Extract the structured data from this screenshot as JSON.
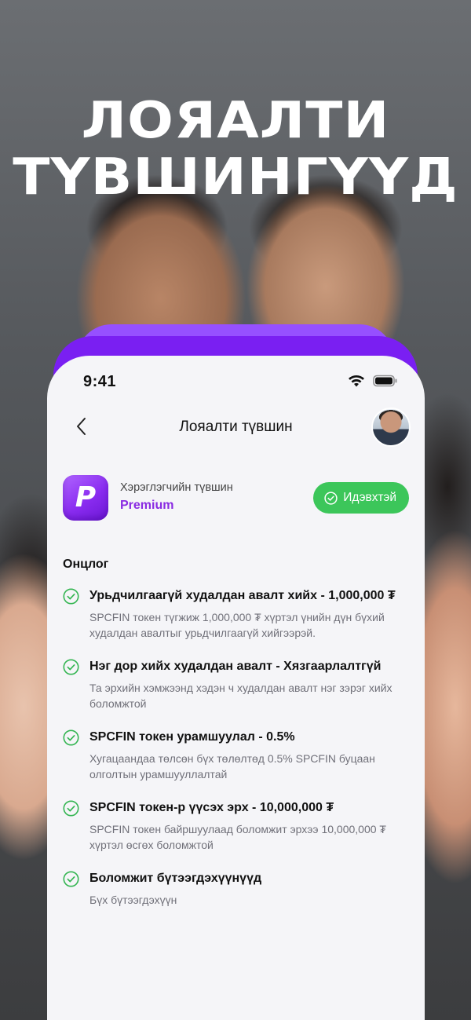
{
  "headline": {
    "line1": "ЛОЯАЛТИ",
    "line2": "ТҮВШИНГҮҮД"
  },
  "status_bar": {
    "time": "9:41"
  },
  "nav": {
    "title": "Лояалти түвшин"
  },
  "tier": {
    "logo_letter": "P",
    "label": "Хэрэглэгчийн түвшин",
    "name": "Premium",
    "status_label": "Идэвхтэй"
  },
  "features_section": {
    "title": "Онцлог",
    "items": [
      {
        "title": "Урьдчилгаагүй худалдан авалт хийх - 1,000,000 ₮",
        "description": "SPCFIN токен түгжиж 1,000,000 ₮ хүртэл үнийн дүн бүхий худалдан авалтыг урьдчилгаагүй хийгээрэй."
      },
      {
        "title": "Нэг дор хийх худалдан авалт - Хязгаарлалтгүй",
        "description": "Та эрхийн хэмжээнд хэдэн ч худалдан авалт нэг зэрэг хийх боломжтой"
      },
      {
        "title": "SPCFIN токен урамшуулал - 0.5%",
        "description": "Хугацаандаа төлсөн бүх төлөлтөд 0.5% SPCFIN буцаан олголтын урамшууллалтай"
      },
      {
        "title": "SPCFIN токен-р үүсэх эрх - 10,000,000 ₮",
        "description": "SPCFIN токен байршуулаад боломжит эрхээ 10,000,000 ₮ хүртэл өсгөх боломжтой"
      },
      {
        "title": "Боломжит бүтээгдэхүүнүүд",
        "description": "Бүх бүтээгдэхүүн"
      }
    ]
  },
  "colors": {
    "accent_purple": "#8a2be2",
    "active_green": "#3cc65a",
    "check_green": "#34b552"
  }
}
